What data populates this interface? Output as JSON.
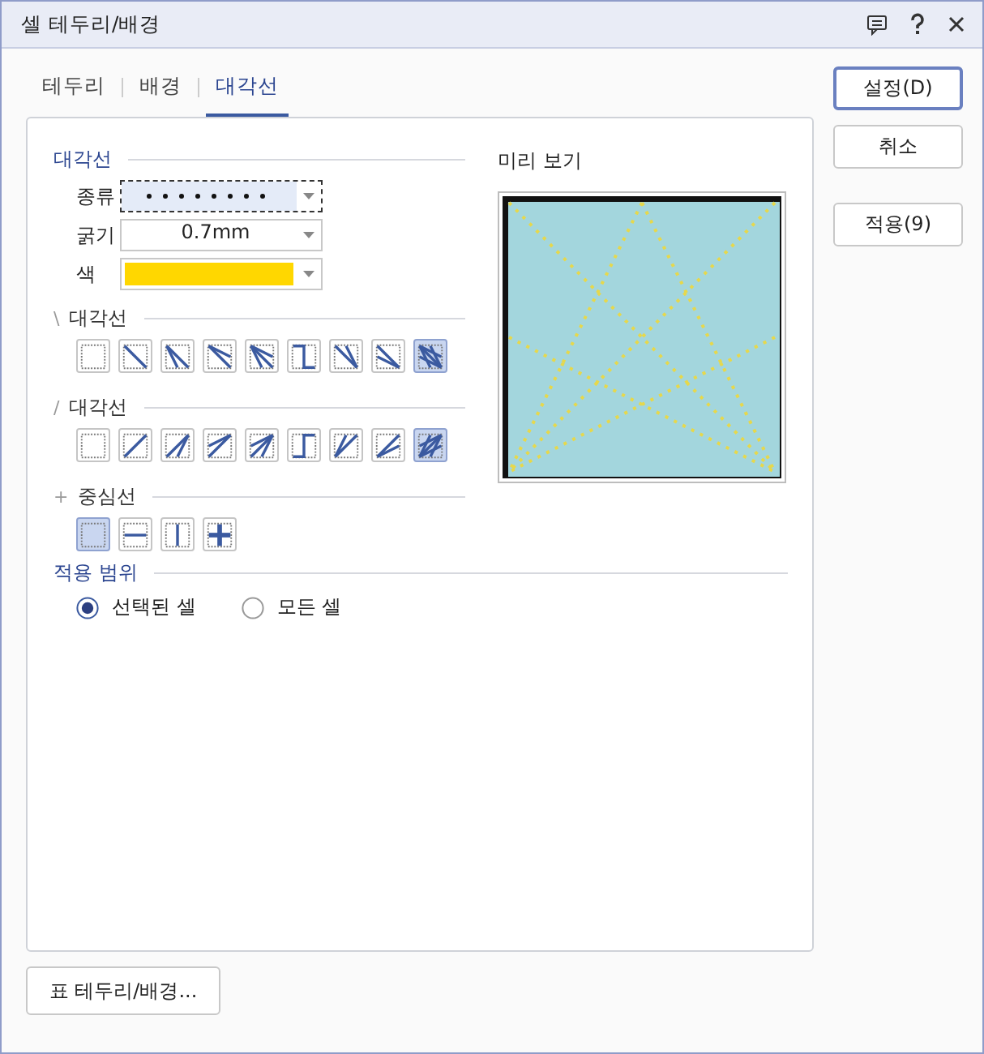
{
  "window": {
    "title": "셀 테두리/배경"
  },
  "tabs": [
    {
      "label": "테두리",
      "selected": false
    },
    {
      "label": "배경",
      "selected": false
    },
    {
      "label": "대각선",
      "selected": true
    }
  ],
  "diagonal": {
    "title": "대각선",
    "fields": [
      {
        "kind": "linetype",
        "label": "종류",
        "focused": true
      },
      {
        "kind": "thickness",
        "label": "굵기",
        "value": "0.7mm"
      },
      {
        "kind": "color",
        "label": "색",
        "color": "#ffd700"
      }
    ]
  },
  "groups": [
    {
      "kind": "backslash",
      "glyph": "\\",
      "title": "대각선",
      "options": [
        {
          "selected": false
        },
        {
          "selected": false
        },
        {
          "selected": false
        },
        {
          "selected": false
        },
        {
          "selected": false
        },
        {
          "selected": false
        },
        {
          "selected": false
        },
        {
          "selected": false
        },
        {
          "selected": true
        }
      ]
    },
    {
      "kind": "slash",
      "glyph": "/",
      "title": "대각선",
      "options": [
        {
          "selected": false
        },
        {
          "selected": false
        },
        {
          "selected": false
        },
        {
          "selected": false
        },
        {
          "selected": false
        },
        {
          "selected": false
        },
        {
          "selected": false
        },
        {
          "selected": false
        },
        {
          "selected": true
        }
      ]
    },
    {
      "kind": "center",
      "glyph": "+",
      "title": "중심선",
      "options": [
        {
          "selected": true
        },
        {
          "selected": false
        },
        {
          "selected": false
        },
        {
          "selected": false
        }
      ]
    }
  ],
  "scope": {
    "title": "적용 범위",
    "options": [
      {
        "label": "선택된 셀",
        "selected": true
      },
      {
        "label": "모든 셀",
        "selected": false
      }
    ]
  },
  "preview": {
    "title": "미리 보기"
  },
  "buttons": [
    {
      "label": "설정(D)",
      "default": true
    },
    {
      "label": "취소",
      "default": false
    },
    {
      "label": "적용(9)",
      "default": false
    }
  ],
  "footer_button": {
    "label": "표 테두리/배경..."
  }
}
